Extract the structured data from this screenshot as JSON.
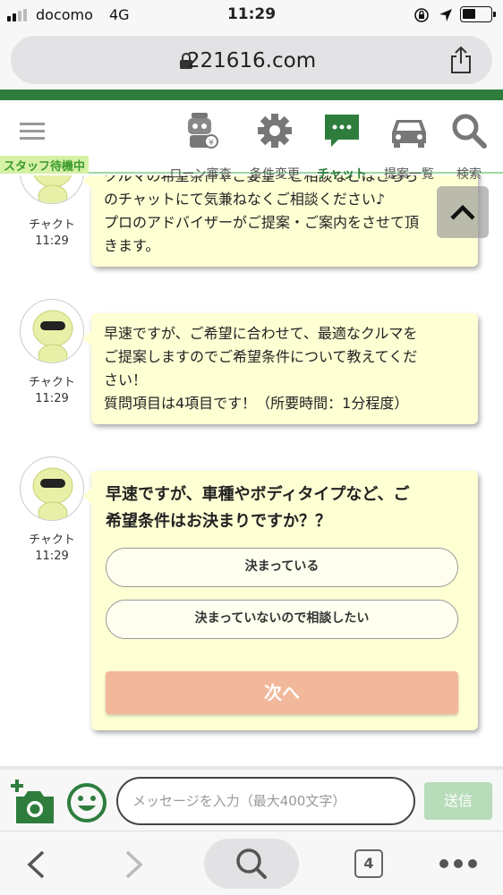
{
  "status_bar": {
    "carrier": "docomo",
    "network": "4G",
    "time": "11:29"
  },
  "url_bar": {
    "url": "221616.com"
  },
  "nav": {
    "items": [
      {
        "label": "ローン審査",
        "icon": "loan-robot-icon"
      },
      {
        "label": "条件変更",
        "icon": "gear-icon"
      },
      {
        "label": "チャット",
        "icon": "chat-icon",
        "active": true
      },
      {
        "label": "提案一覧",
        "icon": "car-icon"
      },
      {
        "label": "検索",
        "icon": "search-icon"
      }
    ],
    "staff_badge": "スタッフ待機中"
  },
  "messages": [
    {
      "sender": "チャクト",
      "time": "11:29",
      "lines": [
        "クルマの希望条件やご要望・ご相談などはこちら",
        "のチャットにて気兼ねなくご相談ください♪",
        "プロのアドバイザーがご提案・ご案内をさせて頂",
        "きます。"
      ]
    },
    {
      "sender": "チャクト",
      "time": "11:29",
      "lines": [
        "早速ですが、ご希望に合わせて、最適なクルマを",
        "ご提案しますのでご希望条件について教えてくだ",
        "さい！",
        "質問項目は4項目です！（所要時間：1分程度）"
      ]
    },
    {
      "sender": "チャクト",
      "time": "11:29",
      "question": [
        "早速ですが、車種やボディタイプなど、ご",
        "希望条件はお決まりですか？？"
      ],
      "options": [
        "決まっている",
        "決まっていないので相談したい"
      ],
      "next_label": "次へ"
    }
  ],
  "input": {
    "placeholder": "メッセージを入力（最大400文字）",
    "send_label": "送信"
  },
  "browser": {
    "tab_count": "4"
  },
  "colors": {
    "brand_green": "#2e7d3d",
    "bubble_bg": "#ffffd4",
    "next_button": "#f2b89c",
    "send_button": "#b7dcb9",
    "staff_badge_bg": "#d6f1a6"
  }
}
